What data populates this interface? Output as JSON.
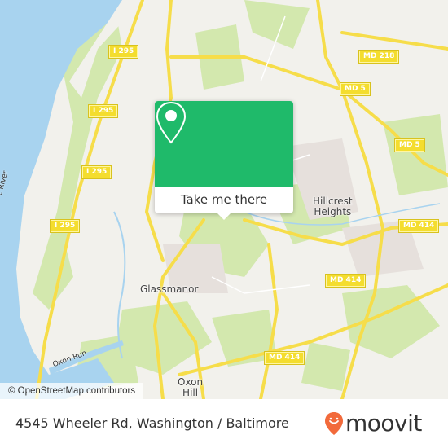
{
  "map": {
    "shields": [
      "I 295",
      "I 295",
      "I 295",
      "I 295",
      "MD 218",
      "MD 5",
      "MD 5",
      "MD 414",
      "MD 414",
      "MD 414"
    ],
    "places": [
      "Hillcrest\nHeights",
      "Glassmanor",
      "Oxon\nHill"
    ],
    "water_labels": [
      "c River",
      "Oxon Run"
    ],
    "attribution": "© OpenStreetMap contributors",
    "colors": {
      "land": "#f2f1ec",
      "water": "#a8d3ef",
      "park": "#cfe5a8",
      "road": "#f6dd4a",
      "accent": "#1fba6a"
    }
  },
  "popup": {
    "icon": "map-pin-icon",
    "button_label": "Take me there"
  },
  "footer": {
    "address": "4545 Wheeler Rd, Washington / Baltimore",
    "logo_text": "moovit",
    "logo_icon": "moovit-pin-icon",
    "logo_color": "#f26a3b"
  }
}
